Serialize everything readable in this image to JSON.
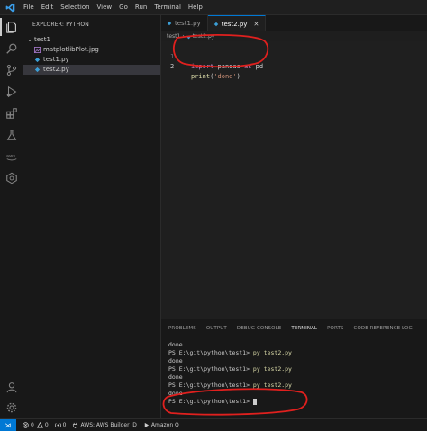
{
  "menu": [
    "File",
    "Edit",
    "Selection",
    "View",
    "Go",
    "Run",
    "Terminal",
    "Help"
  ],
  "explorer": {
    "title": "EXPLORER: PYTHON",
    "folder": "test1",
    "files": [
      {
        "name": "matplotlibPlot.jpg",
        "type": "image"
      },
      {
        "name": "test1.py",
        "type": "python"
      },
      {
        "name": "test2.py",
        "type": "python",
        "selected": true
      }
    ]
  },
  "tabs": [
    {
      "label": "test1.py",
      "active": false
    },
    {
      "label": "test2.py",
      "active": true
    }
  ],
  "breadcrumb": [
    "test1",
    "test2.py"
  ],
  "code": [
    {
      "n": "1",
      "tokens": [
        [
          "kw",
          "import"
        ],
        [
          "plain",
          " pandas "
        ],
        [
          "kw",
          "as"
        ],
        [
          "plain",
          " pd"
        ]
      ]
    },
    {
      "n": "2",
      "tokens": [
        [
          "fn",
          "print"
        ],
        [
          "plain",
          "("
        ],
        [
          "str",
          "'done'"
        ],
        [
          "plain",
          ")"
        ]
      ]
    }
  ],
  "panel_tabs": [
    {
      "label": "PROBLEMS",
      "active": false
    },
    {
      "label": "OUTPUT",
      "active": false
    },
    {
      "label": "DEBUG CONSOLE",
      "active": false
    },
    {
      "label": "TERMINAL",
      "active": true
    },
    {
      "label": "PORTS",
      "active": false
    },
    {
      "label": "CODE REFERENCE LOG",
      "active": false
    }
  ],
  "terminal": [
    {
      "prompt": "done",
      "cmd": ""
    },
    {
      "prompt": "PS E:\\git\\python\\test1> ",
      "cmd": "py test2.py"
    },
    {
      "prompt": "done",
      "cmd": ""
    },
    {
      "prompt": "PS E:\\git\\python\\test1> ",
      "cmd": "py test2.py"
    },
    {
      "prompt": "done",
      "cmd": ""
    },
    {
      "prompt": "PS E:\\git\\python\\test1> ",
      "cmd": "py test2.py"
    },
    {
      "prompt": "done",
      "cmd": ""
    },
    {
      "prompt": "PS E:\\git\\python\\test1> ",
      "cmd": "",
      "cursor": true
    }
  ],
  "status": {
    "errors": "0",
    "warnings": "0",
    "ports": "0",
    "aws": "AWS: AWS Builder ID",
    "amazon_q": "Amazon Q"
  },
  "colors": {
    "accent": "#0078d4",
    "annotation": "#e0201e"
  }
}
